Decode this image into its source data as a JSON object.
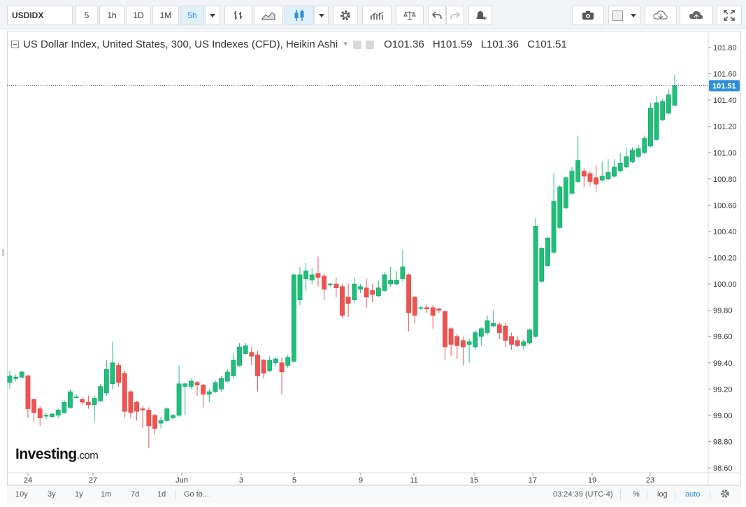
{
  "toolbar": {
    "symbol": "USDIDX",
    "intervals": [
      "5",
      "1h",
      "1D",
      "1M",
      "5h"
    ],
    "active_interval": "5h"
  },
  "legend": {
    "title": "US Dollar Index, United States, 300, US Indexes (CFD), Heikin Ashi",
    "open": "O101.36",
    "high": "H101.59",
    "low": "L101.36",
    "close": "C101.51"
  },
  "logo": {
    "brand": "Investing",
    "suffix": ".com"
  },
  "bottombar": {
    "ranges": [
      "10y",
      "3y",
      "1y",
      "1m",
      "7d",
      "1d"
    ],
    "goto": "Go to...",
    "time": "03:24:39 (UTC-4)",
    "percent": "%",
    "log": "log",
    "auto": "auto"
  },
  "colors": {
    "up": "#26a69a",
    "up_fill": "#1fbf7a",
    "down": "#ef5350",
    "accent": "#2d8fd6",
    "last_price_bg": "#2d8fd6"
  },
  "chart_data": {
    "type": "candlestick",
    "title": "US Dollar Index, United States, 300, US Indexes (CFD), Heikin Ashi",
    "ylim": [
      98.6,
      101.9
    ],
    "y_ticks": [
      "101.80",
      "101.60",
      "101.40",
      "101.20",
      "101.00",
      "100.80",
      "100.60",
      "100.40",
      "100.20",
      "100.00",
      "99.80",
      "99.60",
      "99.40",
      "99.20",
      "99.00",
      "98.80",
      "98.60"
    ],
    "x_ticks": [
      "24",
      "27",
      "Jun",
      "3",
      "5",
      "9",
      "11",
      "15",
      "17",
      "19",
      "23"
    ],
    "last_price": "101.51",
    "candles": [
      [
        99.25,
        99.34,
        99.2,
        99.3
      ],
      [
        99.28,
        99.31,
        99.26,
        99.29
      ],
      [
        99.29,
        99.34,
        99.28,
        99.33
      ],
      [
        99.3,
        99.31,
        98.98,
        99.05
      ],
      [
        99.12,
        99.13,
        98.95,
        99.02
      ],
      [
        99.05,
        99.07,
        98.92,
        98.98
      ],
      [
        99.0,
        99.02,
        98.97,
        99.0
      ],
      [
        98.99,
        99.02,
        98.98,
        99.01
      ],
      [
        99.0,
        99.05,
        98.98,
        99.04
      ],
      [
        99.02,
        99.12,
        99.01,
        99.1
      ],
      [
        99.06,
        99.2,
        99.05,
        99.18
      ],
      [
        99.14,
        99.16,
        99.13,
        99.14
      ],
      [
        99.12,
        99.14,
        99.08,
        99.1
      ],
      [
        99.1,
        99.15,
        99.05,
        99.08
      ],
      [
        99.08,
        99.15,
        98.95,
        99.13
      ],
      [
        99.11,
        99.24,
        99.1,
        99.22
      ],
      [
        99.17,
        99.42,
        99.15,
        99.35
      ],
      [
        99.24,
        99.56,
        99.2,
        99.4
      ],
      [
        99.38,
        99.4,
        99.22,
        99.25
      ],
      [
        99.32,
        99.34,
        98.98,
        99.03
      ],
      [
        99.18,
        99.19,
        98.98,
        99.02
      ],
      [
        99.1,
        99.11,
        98.96,
        99.03
      ],
      [
        99.05,
        99.07,
        98.9,
        99.04
      ],
      [
        99.04,
        99.06,
        98.75,
        98.92
      ],
      [
        99.0,
        99.01,
        98.85,
        98.9
      ],
      [
        98.94,
        98.99,
        98.9,
        98.96
      ],
      [
        98.96,
        99.06,
        98.95,
        99.05
      ],
      [
        98.98,
        99.01,
        98.96,
        99.0
      ],
      [
        99.0,
        99.38,
        98.99,
        99.24
      ],
      [
        99.22,
        99.25,
        99.0,
        99.24
      ],
      [
        99.22,
        99.28,
        99.2,
        99.26
      ],
      [
        99.25,
        99.26,
        99.15,
        99.23
      ],
      [
        99.23,
        99.24,
        99.06,
        99.16
      ],
      [
        99.16,
        99.2,
        99.1,
        99.18
      ],
      [
        99.18,
        99.27,
        99.17,
        99.25
      ],
      [
        99.2,
        99.3,
        99.18,
        99.28
      ],
      [
        99.26,
        99.35,
        99.25,
        99.33
      ],
      [
        99.3,
        99.47,
        99.28,
        99.42
      ],
      [
        99.38,
        99.55,
        99.37,
        99.52
      ],
      [
        99.47,
        99.55,
        99.46,
        99.53
      ],
      [
        99.48,
        99.52,
        99.38,
        99.45
      ],
      [
        99.46,
        99.49,
        99.18,
        99.3
      ],
      [
        99.42,
        99.43,
        99.28,
        99.32
      ],
      [
        99.34,
        99.45,
        99.33,
        99.42
      ],
      [
        99.4,
        99.44,
        99.38,
        99.43
      ],
      [
        99.4,
        99.44,
        99.16,
        99.33
      ],
      [
        99.38,
        99.46,
        99.36,
        99.44
      ],
      [
        99.41,
        100.08,
        99.4,
        100.07
      ],
      [
        99.88,
        100.13,
        99.84,
        100.07
      ],
      [
        100.04,
        100.16,
        99.95,
        100.1
      ],
      [
        100.03,
        100.12,
        100.0,
        100.07
      ],
      [
        100.08,
        100.21,
        99.98,
        100.05
      ],
      [
        100.06,
        100.08,
        99.88,
        99.96
      ],
      [
        100.0,
        100.01,
        99.98,
        100.0
      ],
      [
        100.0,
        100.05,
        99.9,
        99.97
      ],
      [
        99.98,
        100.0,
        99.74,
        99.76
      ],
      [
        99.9,
        100.0,
        99.75,
        99.85
      ],
      [
        99.88,
        100.05,
        99.86,
        100.0
      ],
      [
        99.96,
        100.0,
        99.93,
        99.98
      ],
      [
        99.97,
        100.04,
        99.82,
        99.9
      ],
      [
        99.95,
        100.0,
        99.86,
        99.92
      ],
      [
        99.91,
        100.02,
        99.9,
        99.97
      ],
      [
        99.95,
        100.09,
        99.94,
        100.07
      ],
      [
        100.0,
        100.13,
        99.98,
        100.03
      ],
      [
        100.0,
        100.1,
        99.99,
        100.03
      ],
      [
        100.04,
        100.26,
        100.02,
        100.13
      ],
      [
        100.07,
        100.08,
        99.64,
        99.78
      ],
      [
        99.9,
        99.91,
        99.7,
        99.76
      ],
      [
        99.82,
        99.83,
        99.8,
        99.82
      ],
      [
        99.82,
        99.84,
        99.78,
        99.81
      ],
      [
        99.82,
        99.84,
        99.66,
        99.76
      ],
      [
        99.81,
        99.82,
        99.78,
        99.8
      ],
      [
        99.79,
        99.8,
        99.42,
        99.52
      ],
      [
        99.66,
        99.67,
        99.45,
        99.54
      ],
      [
        99.6,
        99.62,
        99.43,
        99.53
      ],
      [
        99.57,
        99.6,
        99.38,
        99.52
      ],
      [
        99.54,
        99.58,
        99.4,
        99.56
      ],
      [
        99.52,
        99.65,
        99.5,
        99.63
      ],
      [
        99.6,
        99.67,
        99.53,
        99.66
      ],
      [
        99.63,
        99.76,
        99.61,
        99.72
      ],
      [
        99.68,
        99.8,
        99.67,
        99.7
      ],
      [
        99.69,
        99.71,
        99.58,
        99.63
      ],
      [
        99.68,
        99.7,
        99.52,
        99.57
      ],
      [
        99.6,
        99.63,
        99.5,
        99.54
      ],
      [
        99.57,
        99.6,
        99.52,
        99.53
      ],
      [
        99.53,
        99.58,
        99.5,
        99.56
      ],
      [
        99.55,
        99.66,
        99.54,
        99.65
      ],
      [
        99.6,
        100.5,
        99.59,
        100.44
      ],
      [
        100.02,
        100.28,
        100.01,
        100.27
      ],
      [
        100.14,
        100.36,
        100.13,
        100.35
      ],
      [
        100.24,
        100.84,
        100.23,
        100.63
      ],
      [
        100.43,
        100.75,
        100.42,
        100.74
      ],
      [
        100.58,
        100.82,
        100.57,
        100.81
      ],
      [
        100.69,
        100.89,
        100.68,
        100.86
      ],
      [
        100.78,
        101.13,
        100.77,
        100.94
      ],
      [
        100.86,
        100.88,
        100.74,
        100.82
      ],
      [
        100.84,
        100.86,
        100.75,
        100.78
      ],
      [
        100.81,
        100.9,
        100.7,
        100.76
      ],
      [
        100.79,
        100.93,
        100.78,
        100.82
      ],
      [
        100.8,
        100.95,
        100.79,
        100.85
      ],
      [
        100.82,
        100.95,
        100.81,
        100.89
      ],
      [
        100.86,
        101.0,
        100.85,
        100.92
      ],
      [
        100.89,
        101.04,
        100.88,
        100.97
      ],
      [
        100.93,
        101.04,
        100.92,
        101.02
      ],
      [
        100.97,
        101.06,
        100.96,
        101.03
      ],
      [
        101.0,
        101.13,
        100.99,
        101.11
      ],
      [
        101.05,
        101.38,
        101.04,
        101.34
      ],
      [
        101.1,
        101.43,
        101.09,
        101.38
      ],
      [
        101.25,
        101.41,
        101.24,
        101.39
      ],
      [
        101.3,
        101.48,
        101.29,
        101.44
      ],
      [
        101.36,
        101.59,
        101.36,
        101.51
      ]
    ]
  }
}
